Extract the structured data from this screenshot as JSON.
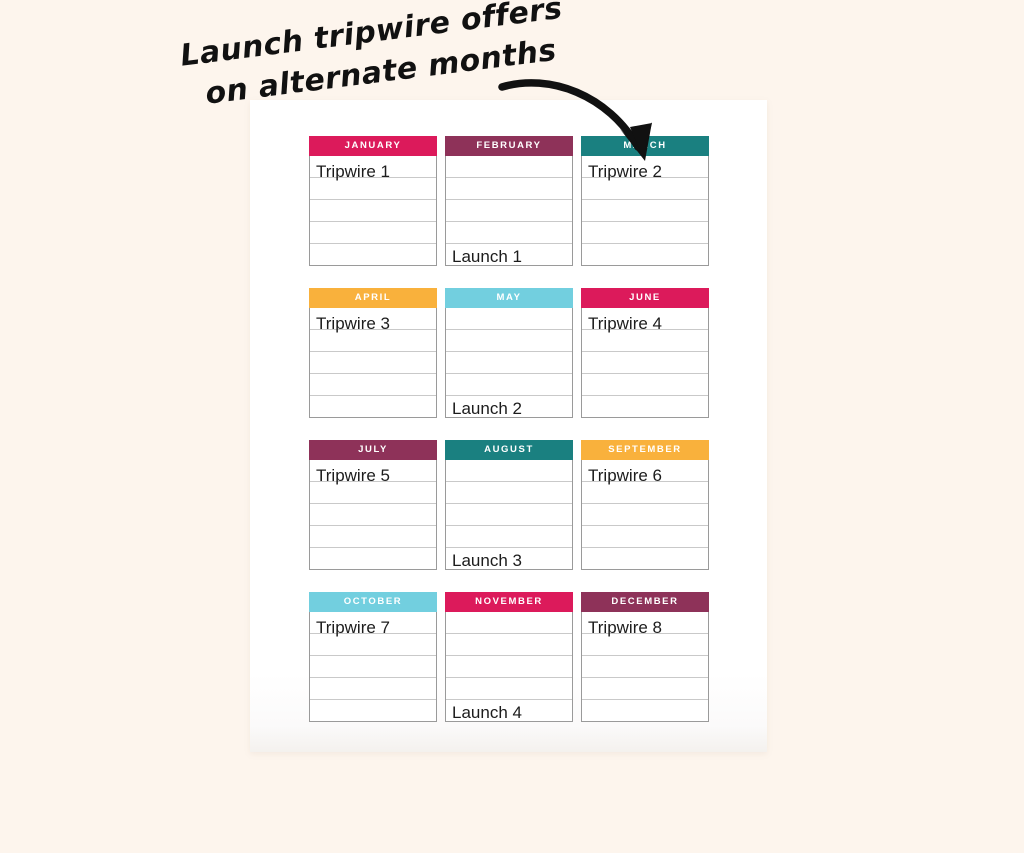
{
  "page": {
    "background_color": "#fdf5ed",
    "paper_color": "#ffffff"
  },
  "annotation": {
    "name": "handwritten-note",
    "line1": "Launch tripwire offers",
    "line2": "on alternate months",
    "arrow": "curved-arrow-to-march",
    "color": "#111111"
  },
  "palette": {
    "crimson": "#dc1a5b",
    "plum": "#8e3259",
    "teal": "#1a8080",
    "orange": "#f9b13c",
    "skyblue": "#72cfdf",
    "cell_border": "#9a9a9a",
    "row_line": "#c9c9c9",
    "text": "#1c1c1c",
    "header_text": "#ffffff"
  },
  "calendar": {
    "rows_per_month": 5,
    "months": [
      {
        "name": "JANUARY",
        "color_key": "crimson",
        "color": "#dc1a5b",
        "entries": [
          {
            "row": 1,
            "text": "Tripwire 1"
          },
          {
            "row": 2,
            "text": ""
          },
          {
            "row": 3,
            "text": ""
          },
          {
            "row": 4,
            "text": ""
          },
          {
            "row": 5,
            "text": ""
          }
        ]
      },
      {
        "name": "FEBRUARY",
        "color_key": "plum",
        "color": "#8e3259",
        "entries": [
          {
            "row": 1,
            "text": ""
          },
          {
            "row": 2,
            "text": ""
          },
          {
            "row": 3,
            "text": ""
          },
          {
            "row": 4,
            "text": ""
          },
          {
            "row": 5,
            "text": "Launch 1"
          }
        ]
      },
      {
        "name": "MARCH",
        "color_key": "teal",
        "color": "#1a8080",
        "entries": [
          {
            "row": 1,
            "text": "Tripwire 2"
          },
          {
            "row": 2,
            "text": ""
          },
          {
            "row": 3,
            "text": ""
          },
          {
            "row": 4,
            "text": ""
          },
          {
            "row": 5,
            "text": ""
          }
        ]
      },
      {
        "name": "APRIL",
        "color_key": "orange",
        "color": "#f9b13c",
        "entries": [
          {
            "row": 1,
            "text": "Tripwire 3"
          },
          {
            "row": 2,
            "text": ""
          },
          {
            "row": 3,
            "text": ""
          },
          {
            "row": 4,
            "text": ""
          },
          {
            "row": 5,
            "text": ""
          }
        ]
      },
      {
        "name": "MAY",
        "color_key": "skyblue",
        "color": "#72cfdf",
        "entries": [
          {
            "row": 1,
            "text": ""
          },
          {
            "row": 2,
            "text": ""
          },
          {
            "row": 3,
            "text": ""
          },
          {
            "row": 4,
            "text": ""
          },
          {
            "row": 5,
            "text": "Launch 2"
          }
        ]
      },
      {
        "name": "JUNE",
        "color_key": "crimson",
        "color": "#dc1a5b",
        "entries": [
          {
            "row": 1,
            "text": "Tripwire 4"
          },
          {
            "row": 2,
            "text": ""
          },
          {
            "row": 3,
            "text": ""
          },
          {
            "row": 4,
            "text": ""
          },
          {
            "row": 5,
            "text": ""
          }
        ]
      },
      {
        "name": "JULY",
        "color_key": "plum",
        "color": "#8e3259",
        "entries": [
          {
            "row": 1,
            "text": "Tripwire 5"
          },
          {
            "row": 2,
            "text": ""
          },
          {
            "row": 3,
            "text": ""
          },
          {
            "row": 4,
            "text": ""
          },
          {
            "row": 5,
            "text": ""
          }
        ]
      },
      {
        "name": "AUGUST",
        "color_key": "teal",
        "color": "#1a8080",
        "entries": [
          {
            "row": 1,
            "text": ""
          },
          {
            "row": 2,
            "text": ""
          },
          {
            "row": 3,
            "text": ""
          },
          {
            "row": 4,
            "text": ""
          },
          {
            "row": 5,
            "text": "Launch 3"
          }
        ]
      },
      {
        "name": "SEPTEMBER",
        "color_key": "orange",
        "color": "#f9b13c",
        "entries": [
          {
            "row": 1,
            "text": "Tripwire 6"
          },
          {
            "row": 2,
            "text": ""
          },
          {
            "row": 3,
            "text": ""
          },
          {
            "row": 4,
            "text": ""
          },
          {
            "row": 5,
            "text": ""
          }
        ]
      },
      {
        "name": "OCTOBER",
        "color_key": "skyblue",
        "color": "#72cfdf",
        "entries": [
          {
            "row": 1,
            "text": "Tripwire 7"
          },
          {
            "row": 2,
            "text": ""
          },
          {
            "row": 3,
            "text": ""
          },
          {
            "row": 4,
            "text": ""
          },
          {
            "row": 5,
            "text": ""
          }
        ]
      },
      {
        "name": "NOVEMBER",
        "color_key": "crimson",
        "color": "#dc1a5b",
        "entries": [
          {
            "row": 1,
            "text": ""
          },
          {
            "row": 2,
            "text": ""
          },
          {
            "row": 3,
            "text": ""
          },
          {
            "row": 4,
            "text": ""
          },
          {
            "row": 5,
            "text": "Launch 4"
          }
        ]
      },
      {
        "name": "DECEMBER",
        "color_key": "plum",
        "color": "#8e3259",
        "entries": [
          {
            "row": 1,
            "text": "Tripwire 8"
          },
          {
            "row": 2,
            "text": ""
          },
          {
            "row": 3,
            "text": ""
          },
          {
            "row": 4,
            "text": ""
          },
          {
            "row": 5,
            "text": ""
          }
        ]
      }
    ]
  }
}
